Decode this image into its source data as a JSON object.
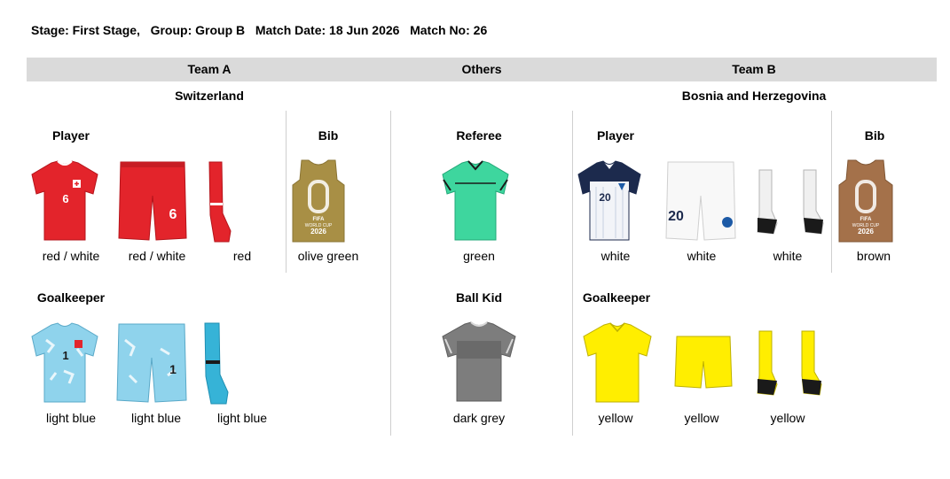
{
  "header": {
    "stage": "Stage: First Stage,",
    "group": "Group: Group B",
    "match_date": "Match Date: 18 Jun 2026",
    "match_no": "Match No: 26"
  },
  "columns": {
    "team_a": "Team A",
    "others": "Others",
    "team_b": "Team B"
  },
  "team_a": {
    "country": "Switzerland",
    "player_title": "Player",
    "bib_title": "Bib",
    "player": {
      "shirt": "red / white",
      "shorts": "red / white",
      "socks": "red",
      "shirt_number": "6",
      "shorts_number": "6"
    },
    "bib": "olive green",
    "goalkeeper_title": "Goalkeeper",
    "goalkeeper": {
      "shirt": "light blue",
      "shorts": "light blue",
      "socks": "light blue",
      "shirt_number": "1",
      "shorts_number": "1"
    }
  },
  "others": {
    "referee_title": "Referee",
    "referee": "green",
    "ball_kid_title": "Ball Kid",
    "ball_kid": "dark grey"
  },
  "team_b": {
    "country": "Bosnia and Herzegovina",
    "player_title": "Player",
    "bib_title": "Bib",
    "player": {
      "shirt": "white",
      "shorts": "white",
      "socks": "white",
      "shirt_number": "20",
      "shorts_number": "20"
    },
    "bib": "brown",
    "goalkeeper_title": "Goalkeeper",
    "goalkeeper": {
      "shirt": "yellow",
      "shorts": "yellow",
      "socks": "yellow"
    }
  },
  "bib_logo": {
    "line1": "FIFA",
    "line2": "WORLD CUP",
    "line3": "2026"
  },
  "colors": {
    "header_bar": "#dadada",
    "swiss_red": "#e3242b",
    "gk_light_blue": "#8fd3ec",
    "olive_green": "#a88f45",
    "referee_green": "#3ed69e",
    "bosnia_navy": "#1c2a4d",
    "brown": "#a4714a",
    "dark_grey": "#7d7d7d",
    "yellow": "#ffee00"
  },
  "icons": [
    "shirt-icon",
    "shorts-icon",
    "socks-icon",
    "bib-icon"
  ]
}
